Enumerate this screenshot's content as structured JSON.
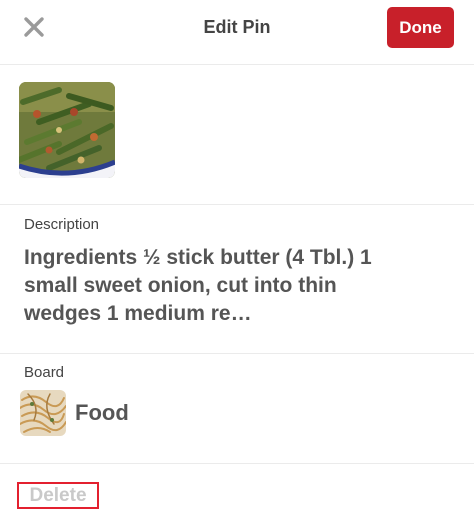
{
  "header": {
    "title": "Edit Pin",
    "done_label": "Done",
    "close_icon": "close-icon"
  },
  "pin": {
    "image": "green-beans-dish-image"
  },
  "description": {
    "label": "Description",
    "text": "Ingredients ½ stick butter (4 Tbl.) 1 small sweet onion, cut into thin wedges 1 medium re…"
  },
  "board": {
    "label": "Board",
    "name": "Food",
    "image": "pasta-dish-image"
  },
  "actions": {
    "delete_label": "Delete"
  },
  "colors": {
    "accent": "#c8202a",
    "delete_outline": "#e3202f",
    "delete_text": "#c9c9c9",
    "text": "#555555"
  }
}
